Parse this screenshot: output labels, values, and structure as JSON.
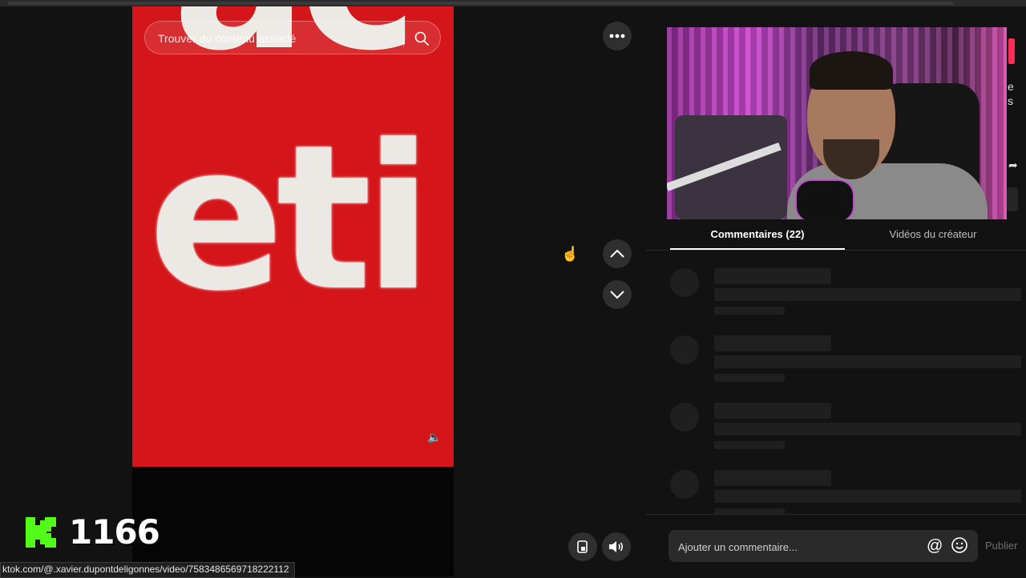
{
  "search": {
    "placeholder": "Trouver du contenu associé",
    "icon": "search-icon"
  },
  "video": {
    "overlay_text": "eti",
    "overlay_text_top": "ac"
  },
  "controls": {
    "more_icon": "more-horizontal-icon",
    "prev_icon": "chevron-up-icon",
    "next_icon": "chevron-down-icon",
    "pip_icon": "picture-in-picture-icon",
    "volume_icon": "volume-icon"
  },
  "tabs": [
    {
      "label": "Commentaires (22)",
      "active": true
    },
    {
      "label": "Vidéos du créateur",
      "active": false
    }
  ],
  "edge_text": {
    "t1": "e",
    "t2": "s",
    "t3": "➦"
  },
  "comment": {
    "placeholder": "Ajouter un commentaire...",
    "at_label": "@",
    "publish_label": "Publier"
  },
  "status_url": "ktok.com/@.xavier.dupontdeligonnes/video/7583486569718222112",
  "overlay_counter": {
    "value": "1166",
    "logo_color": "#53fc18"
  },
  "colors": {
    "accent": "#fe2c55",
    "background": "#121212",
    "video_red": "#d4161a"
  }
}
